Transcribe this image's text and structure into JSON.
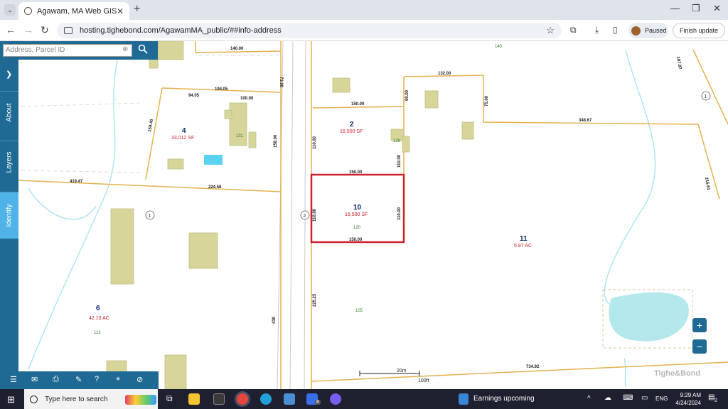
{
  "browser": {
    "tab_title": "Agawam, MA Web GIS",
    "url": "hosting.tighebond.com/AgawamMA_public/##info-address",
    "profile_status": "Paused",
    "update_button": "Finish update"
  },
  "gis": {
    "search_placeholder": "Address, Parcel ID",
    "side_tabs": [
      "About",
      "Layers",
      "Identify"
    ],
    "zoom_in": "+",
    "zoom_out": "−",
    "watermark": "Tighe&Bond",
    "scale": {
      "metric": "20m",
      "imperial": "100ft"
    }
  },
  "map": {
    "road_labels": [
      "1",
      "2",
      "1"
    ],
    "parcels": [
      {
        "id": "4",
        "area": "33,012 SF",
        "house": "131"
      },
      {
        "id": "2",
        "area": "16,500 SF",
        "house": "128"
      },
      {
        "id": "10",
        "area": "16,500 SF",
        "house": "120"
      },
      {
        "id": "11",
        "area": "5.87 AC",
        "house": "105"
      },
      {
        "id": "6",
        "area": "42.13 AC",
        "house": "113"
      }
    ],
    "top_house": "140",
    "dimensions": [
      "140.00",
      "73.00",
      "194.05",
      "94.05",
      "100.00",
      "159.40",
      "158.00",
      "419.47",
      "224.58",
      "150.00",
      "110.00",
      "150.00",
      "110.00",
      "110.00",
      "150.00",
      "110.00",
      "132.00",
      "90.00",
      "75.00",
      "348.67",
      "197.87",
      "216.61",
      "225.25",
      "430",
      "734.92",
      "150.00"
    ]
  },
  "taskbar": {
    "search_text": "Type here to search",
    "badge": "8",
    "earnings": "Earnings upcoming",
    "language": "ENG",
    "time": "9:29 AM",
    "date": "4/24/2024",
    "notifications": "2"
  },
  "colors": {
    "selected_parcel": "#d0202a",
    "lot_line": "#e3b24d",
    "sidebar": "#1f6a94",
    "active_tab": "#4fb3e8",
    "building": "#d8d59b",
    "water": "#b5e8ec"
  }
}
